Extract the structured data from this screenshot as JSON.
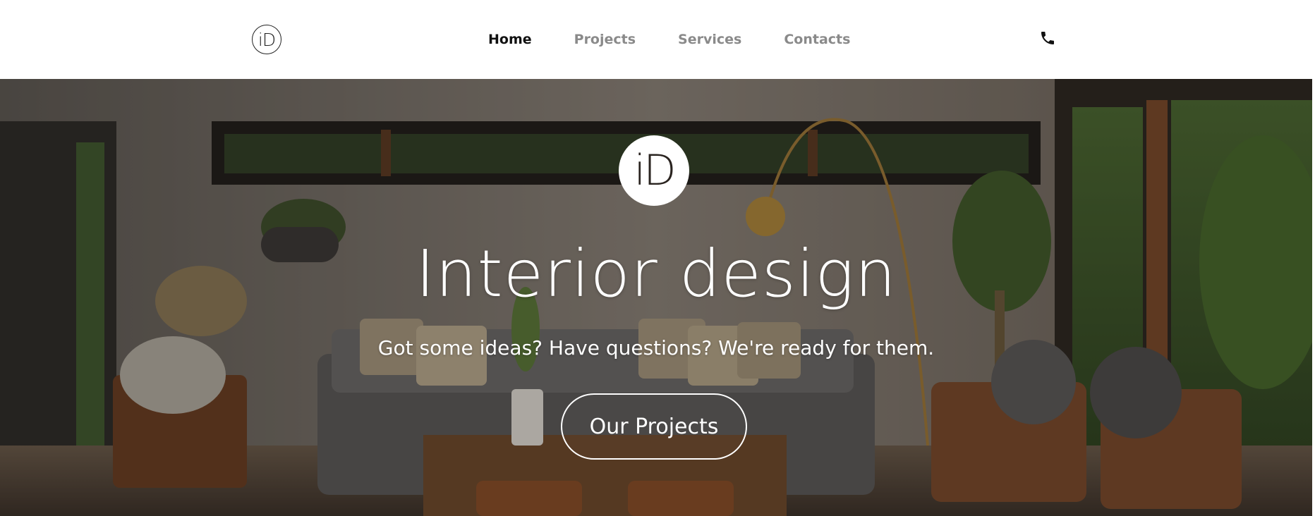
{
  "header": {
    "logo_text": "iD",
    "nav": [
      {
        "label": "Home",
        "active": true
      },
      {
        "label": "Projects",
        "active": false
      },
      {
        "label": "Services",
        "active": false
      },
      {
        "label": "Contacts",
        "active": false
      }
    ],
    "phone_icon": "phone-icon"
  },
  "hero": {
    "logo_text": "iD",
    "title": "Interior design",
    "subtitle": "Got some ideas? Have questions? We're ready for them.",
    "button_label": "Our Projects",
    "background": "living-room-photo"
  },
  "colors": {
    "nav_active": "#111111",
    "nav_inactive": "#8a8a8a",
    "hero_text": "#ffffff"
  }
}
